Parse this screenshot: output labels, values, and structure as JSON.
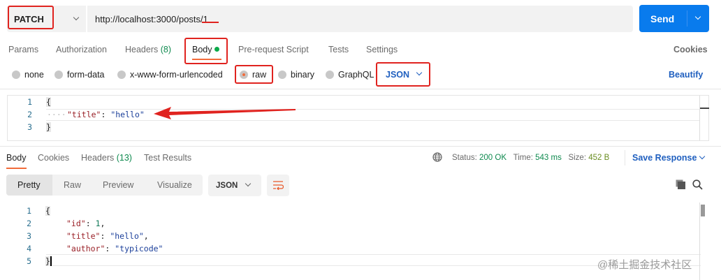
{
  "request": {
    "method": "PATCH",
    "url": "http://localhost:3000/posts/1",
    "send_label": "Send"
  },
  "request_tabs": [
    {
      "label": "Params"
    },
    {
      "label": "Authorization"
    },
    {
      "label": "Headers",
      "count": "(8)"
    },
    {
      "label": "Body"
    },
    {
      "label": "Pre-request Script"
    },
    {
      "label": "Tests"
    },
    {
      "label": "Settings"
    }
  ],
  "cookies_label": "Cookies",
  "body_types": [
    "none",
    "form-data",
    "x-www-form-urlencoded",
    "raw",
    "binary",
    "GraphQL"
  ],
  "body_format": "JSON",
  "beautify_label": "Beautify",
  "request_body": {
    "line_numbers": [
      "1",
      "2",
      "3"
    ],
    "open": "{",
    "key": "\"title\"",
    "value": "\"hello\"",
    "close": "}"
  },
  "response_tabs": [
    {
      "label": "Body"
    },
    {
      "label": "Cookies"
    },
    {
      "label": "Headers",
      "count": "(13)"
    },
    {
      "label": "Test Results"
    }
  ],
  "status": {
    "status_label": "Status:",
    "status_value": "200 OK",
    "time_label": "Time:",
    "time_value": "543 ms",
    "size_label": "Size:",
    "size_value": "452 B"
  },
  "save_response_label": "Save Response",
  "view_modes": [
    "Pretty",
    "Raw",
    "Preview",
    "Visualize"
  ],
  "response_format": "JSON",
  "response_body": {
    "line_numbers": [
      "1",
      "2",
      "3",
      "4",
      "5"
    ],
    "open": "{",
    "id_key": "\"id\"",
    "id_value": "1",
    "title_key": "\"title\"",
    "title_value": "\"hello\"",
    "author_key": "\"author\"",
    "author_value": "\"typicode\"",
    "close": "}"
  },
  "watermark": "@稀土掘金技术社区",
  "colors": {
    "accent": "#097bed",
    "annotation": "#e0231f",
    "active_tab": "#f26b3a",
    "success": "#0f8a4f"
  }
}
